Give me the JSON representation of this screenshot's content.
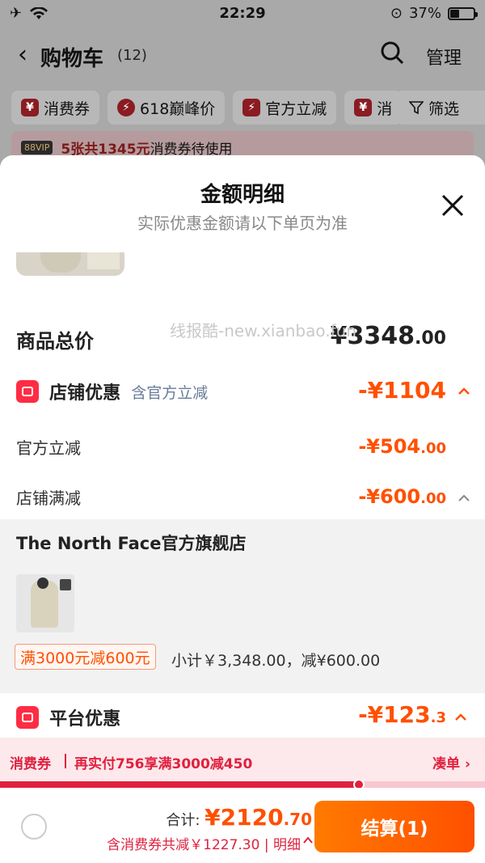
{
  "status_bar": {
    "time": "22:29",
    "battery": "37%",
    "battery_level": 0.37
  },
  "header": {
    "title": "购物车",
    "count": "(12)",
    "manage_label": "管理"
  },
  "chips": [
    {
      "icon": "coupon-icon",
      "label": "消费券"
    },
    {
      "icon": "bolt-icon",
      "label": "618巅峰价"
    },
    {
      "icon": "bolt-icon",
      "label": "官方立减"
    },
    {
      "icon": "coupon-icon",
      "label": "消"
    }
  ],
  "filter_label": "筛选",
  "vip_banner": {
    "badge": "88VIP",
    "highlight": "5张共1345元",
    "text": "消费券待使用"
  },
  "sheet": {
    "title": "金额明细",
    "subtitle": "实际优惠金额请以下单页为准",
    "total": {
      "label": "商品总价",
      "currency": "¥",
      "int": "3348",
      "dec": ".00"
    },
    "shop_discount": {
      "label": "店铺优惠",
      "note": "含官方立减",
      "amount_int": "-¥1104",
      "amount_dec": ""
    },
    "lines": [
      {
        "label": "官方立减",
        "amount_int": "-¥504",
        "amount_dec": ".00"
      },
      {
        "label": "店铺满减",
        "amount_int": "-¥600",
        "amount_dec": ".00"
      }
    ],
    "store": {
      "name": "The North Face官方旗舰店",
      "promo": "满3000元减600元",
      "subtotal": "小计￥3,348.00，减¥600.00"
    },
    "platform": {
      "label": "平台优惠",
      "amount_int": "-¥123",
      "amount_dec": ".3"
    }
  },
  "watermark": "线报酷-new.xianbao.fun",
  "coupon_strip": {
    "tag": "消费券",
    "text": "再实付756享满3000减450",
    "action": "凑单",
    "progress": 0.74
  },
  "bottom": {
    "total_label": "合计: ",
    "currency": "¥",
    "amount_int": "2120",
    "amount_dec": ".70",
    "discount_text": "含消费券共减￥1227.30",
    "detail_label": "明细",
    "checkout_label": "结算(1)"
  },
  "colors": {
    "accent": "#ff5000",
    "coupon_red": "#e0213e",
    "shop_icon": "#ff2c44"
  }
}
